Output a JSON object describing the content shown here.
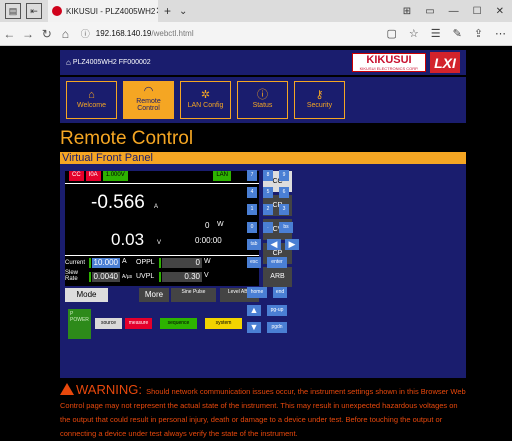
{
  "browser": {
    "tab_title": "KIKUSUI - PLZ4005WH2",
    "url_host": "192.168.140.19",
    "url_path": "/webctl.html"
  },
  "header": {
    "model": "PLZ4005WH2 FF000002",
    "logo_main": "KIKUSUI",
    "logo_sub": "KIKUSUI ELECTRONICS CORP.",
    "lxi_logo": "LXI"
  },
  "nav": {
    "tabs": [
      {
        "label": "Welcome",
        "icon": "home-icon"
      },
      {
        "label": "Remote Control",
        "icon": "gauge-icon"
      },
      {
        "label": "LAN Config",
        "icon": "gear-icon"
      },
      {
        "label": "Status",
        "icon": "info-icon"
      },
      {
        "label": "Security",
        "icon": "key-icon"
      }
    ]
  },
  "page_title": "Remote Control",
  "panel_title": "Virtual Front Panel",
  "display": {
    "indicators": {
      "cc": "CC",
      "ioa": "I0A",
      "v": "1.000V",
      "lan": "LAN"
    },
    "current_value": "-0.566",
    "current_unit": "A",
    "power_value": "0",
    "power_unit": "W",
    "voltage_value": "0.03",
    "voltage_unit": "V",
    "time_value": "0:00:00",
    "current_label": "Current",
    "current_set": "10.000",
    "current_set_unit": "A",
    "slew_label": "Slew Rate",
    "slew_set": "0.0040",
    "slew_unit": "A/μs",
    "oppl_label": "OPPL",
    "oppl_value": "0",
    "oppl_unit": "W",
    "uvpl_label": "UVPL",
    "uvpl_value": "0.30",
    "uvpl_unit": "V"
  },
  "modes": {
    "cc": "CC",
    "cr": "CR",
    "cv": "CV",
    "cp": "CP",
    "arb": "ARB"
  },
  "bottom_buttons": {
    "mode": "Mode",
    "more": "More",
    "sine": "Sine Pulse",
    "level": "Level ABC"
  },
  "keypad": {
    "row1": [
      "7",
      "8",
      "9"
    ],
    "row2": [
      "4",
      "5",
      "6"
    ],
    "row3": [
      "1",
      "2",
      "3"
    ],
    "row4": [
      "0",
      ".",
      "bs"
    ],
    "tab": "tab",
    "esc": "esc",
    "enter": "enter",
    "home": "home",
    "end": "end",
    "pgup": "pg-up",
    "pgdn": "pgdn"
  },
  "status_panel": {
    "box_text": "P  POWER",
    "buttons": [
      "source",
      "measure",
      "sequence",
      "system"
    ],
    "colors": [
      "#d9d9d9",
      "#e4002b",
      "#2db300",
      "#f2d400"
    ]
  },
  "warning": {
    "title": "WARNING:",
    "text": "Should network communication issues occur, the instrument settings shown in this Browser Web Control page may not represent the actual state of the instrument. This may result in unexpected hazardous voltages on the output that could result in personal injury, death or damage to a device under test. Before touching the output or connecting a device under test always verify the state of the instrument."
  },
  "colors": {
    "navy": "#1a1d6e",
    "orange": "#f5a623",
    "key_blue": "#4a7fd4",
    "warning": "#e8480c"
  }
}
